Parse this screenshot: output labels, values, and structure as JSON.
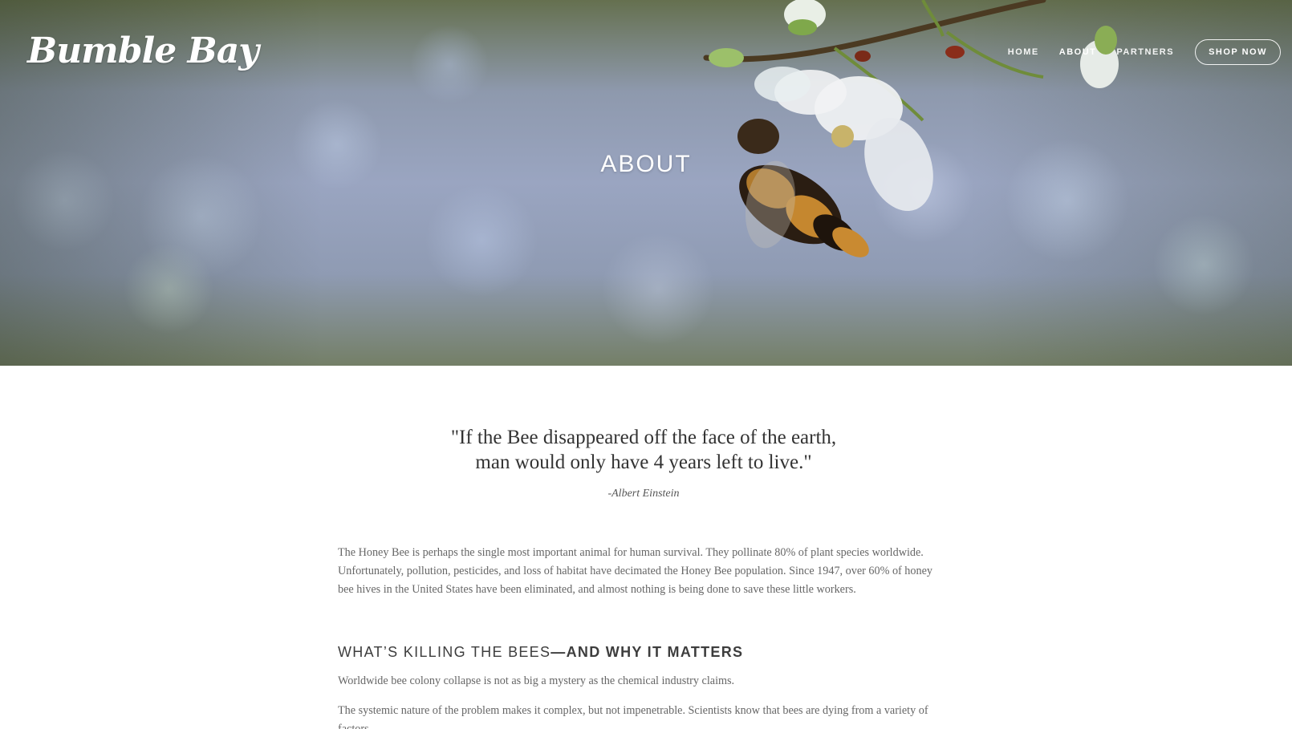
{
  "site": {
    "logo_text": "Bumble Bay"
  },
  "nav": {
    "items": [
      {
        "label": "HOME"
      },
      {
        "label": "ABOUT"
      },
      {
        "label": "PARTNERS"
      }
    ],
    "cta_label": "SHOP NOW",
    "active": "ABOUT"
  },
  "hero": {
    "title": "ABOUT"
  },
  "quote": {
    "line1": "\"If the Bee disappeared off the face of the earth,",
    "line2": "man would only have 4 years left to live.\"",
    "attribution": "-Albert Einstein"
  },
  "intro": {
    "text": "The Honey Bee is perhaps the single most important animal for human survival.  They pollinate 80% of plant species worldwide. Unfortunately, pollution, pesticides, and loss of habitat have decimated the Honey Bee population.  Since 1947, over 60% of honey bee hives in the United States have been eliminated, and almost nothing is being done to save these little workers."
  },
  "section": {
    "heading_light": "WHAT’S KILLING THE BEES",
    "heading_bold": "—AND WHY IT MATTERS",
    "para1": "Worldwide bee colony collapse is not as big a mystery as the chemical industry claims.",
    "para2": "The systemic nature of the problem makes it complex, but not impenetrable. Scientists know that bees are dying from a variety of factors"
  },
  "colors": {
    "hero_overlay_text": "#ffffff",
    "body_text": "#666666",
    "heading_text": "#3d3d3d"
  }
}
